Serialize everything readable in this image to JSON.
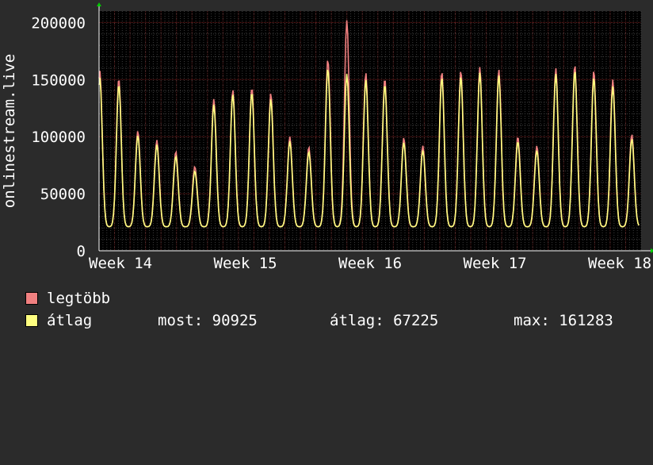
{
  "chart_data": {
    "type": "line",
    "ylabel": "onlinestream.live",
    "ylim": [
      0,
      210000
    ],
    "y_ticks": [
      0,
      50000,
      100000,
      150000,
      200000
    ],
    "y_tick_labels": [
      "0",
      "50000",
      "100000",
      "150000",
      "200000"
    ],
    "x_tick_labels": [
      "Week 14",
      "Week 15",
      "Week 16",
      "Week 17",
      "Week 18"
    ],
    "grid": true,
    "days": 35,
    "series": [
      {
        "name": "legtöbb",
        "color": "#f08080",
        "daily_peaks": [
          158000,
          151000,
          105000,
          97000,
          87000,
          74000,
          133000,
          141000,
          143000,
          138000,
          100000,
          91000,
          168000,
          202000,
          156000,
          151000,
          99000,
          92000,
          157000,
          158000,
          161000,
          159000,
          100000,
          92000,
          160000,
          163000,
          158000,
          150000,
          102000
        ]
      },
      {
        "name": "átlag",
        "color": "#ffff80",
        "daily_peaks": [
          152000,
          146000,
          101000,
          93000,
          83000,
          70000,
          128000,
          137000,
          139000,
          133000,
          96000,
          87000,
          160000,
          155000,
          150000,
          146000,
          95000,
          88000,
          152000,
          153000,
          156000,
          154000,
          96000,
          88000,
          155000,
          158000,
          152000,
          144000,
          98000
        ]
      }
    ]
  },
  "legend": {
    "max_label": "legtöbb",
    "avg_label": "átlag",
    "now_text": "most: 90925",
    "mean_text": "átlag: 67225",
    "max_text": "max: 161283",
    "max_color": "#f08080",
    "avg_color": "#ffff80"
  }
}
